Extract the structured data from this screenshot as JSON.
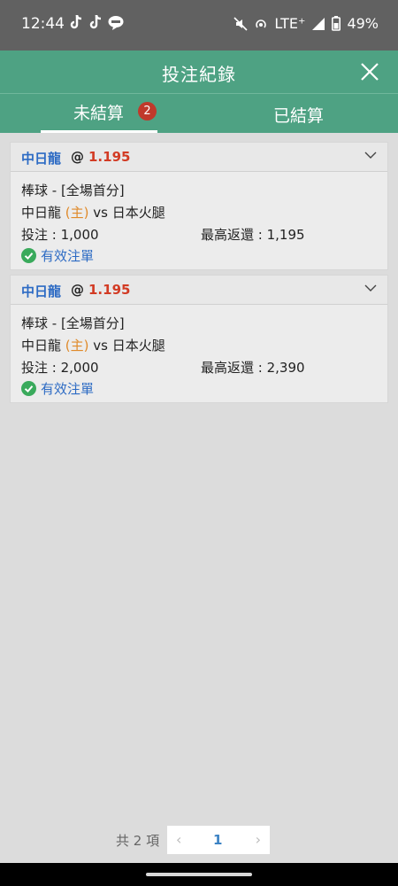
{
  "status_bar": {
    "time": "12:44",
    "network": "LTE⁺",
    "battery": "49%",
    "icons": [
      "tiktok-icon",
      "tiktok-icon",
      "line-icon",
      "mute-icon",
      "hotspot-icon",
      "signal-icon",
      "battery-icon"
    ]
  },
  "header": {
    "title": "投注紀錄"
  },
  "tabs": {
    "open": {
      "label": "未結算",
      "badge": "2"
    },
    "settled": {
      "label": "已結算"
    }
  },
  "bets": [
    {
      "team": "中日龍",
      "at": "@",
      "odds": "1.195",
      "market": "棒球 - [全場首分]",
      "home_team": "中日龍",
      "home_tag": "(主)",
      "vs": "vs",
      "away_team": "日本火腿",
      "stake": "投注 : 1,000",
      "max_return": "最高返還 : 1,195",
      "status": "有效注單"
    },
    {
      "team": "中日龍",
      "at": "@",
      "odds": "1.195",
      "market": "棒球 - [全場首分]",
      "home_team": "中日龍",
      "home_tag": "(主)",
      "vs": "vs",
      "away_team": "日本火腿",
      "stake": "投注 : 2,000",
      "max_return": "最高返還 : 2,390",
      "status": "有效注單"
    }
  ],
  "pager": {
    "total": "共 2 項",
    "prev": "‹",
    "page": "1",
    "next": "›"
  },
  "colors": {
    "header": "#4ea283",
    "team": "#2d6bc4",
    "odds": "#d23b24",
    "badge": "#c0392b",
    "valid": "#3aaa5c"
  }
}
